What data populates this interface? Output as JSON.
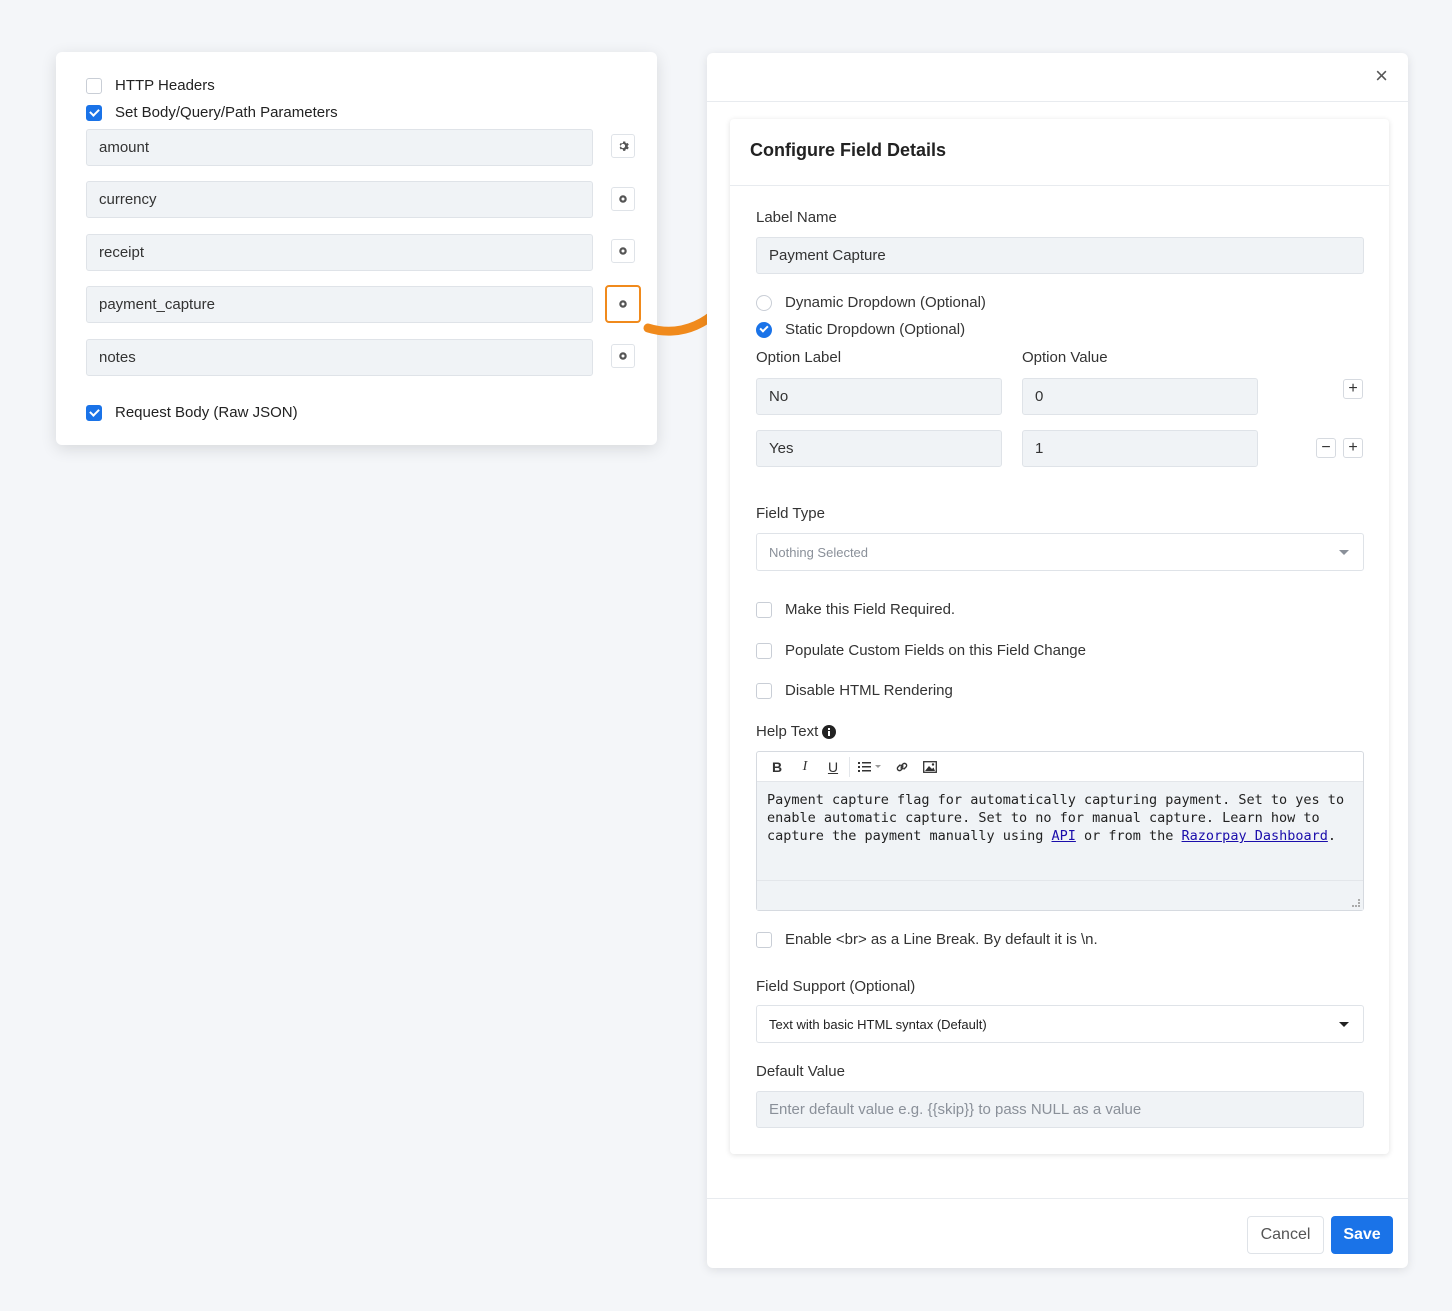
{
  "left_panel": {
    "http_headers_label": "HTTP Headers",
    "set_params_label": "Set Body/Query/Path Parameters",
    "params": [
      "amount",
      "currency",
      "receipt",
      "payment_capture",
      "notes"
    ],
    "request_body_label": "Request Body (Raw JSON)"
  },
  "modal": {
    "close_glyph": "×",
    "title": "Configure Field Details",
    "label_name_label": "Label Name",
    "label_name_value": "Payment Capture",
    "dynamic_dropdown_label": "Dynamic Dropdown (Optional)",
    "static_dropdown_label": "Static Dropdown (Optional)",
    "option_label_header": "Option Label",
    "option_value_header": "Option Value",
    "options": [
      {
        "label": "No",
        "value": "0"
      },
      {
        "label": "Yes",
        "value": "1"
      }
    ],
    "plus_glyph": "+",
    "minus_glyph": "−",
    "field_type_label": "Field Type",
    "field_type_value": "Nothing Selected",
    "make_required_label": "Make this Field Required.",
    "populate_custom_label": "Populate Custom Fields on this Field Change",
    "disable_html_label": "Disable HTML Rendering",
    "help_text_label": "Help Text",
    "help_text_before_api": "Payment capture flag for automatically capturing payment. Set to yes to enable automatic capture. Set to no for manual capture. Learn how to capture the payment manually using ",
    "help_text_api_link": "API",
    "help_text_middle": " or from the ",
    "help_text_dashboard_link": "Razorpay Dashboard",
    "help_text_end": ".",
    "toolbar": {
      "bold": "B",
      "italic": "I",
      "underline": "U"
    },
    "enable_br_label": "Enable <br> as a Line Break. By default it is \\n.",
    "field_support_label": "Field Support (Optional)",
    "field_support_value": "Text with basic HTML syntax (Default)",
    "default_value_label": "Default Value",
    "default_value_placeholder": "Enter default value e.g. {{skip}} to pass NULL as a value",
    "cancel_label": "Cancel",
    "save_label": "Save"
  },
  "colors": {
    "accent": "#1a73e8",
    "highlight": "#f08a1c"
  },
  "icons": [
    "gear-icon",
    "close-icon",
    "info-icon",
    "bold-icon",
    "italic-icon",
    "underline-icon",
    "list-icon",
    "link-icon",
    "image-icon",
    "arrow-icon",
    "chevron-down-icon"
  ]
}
